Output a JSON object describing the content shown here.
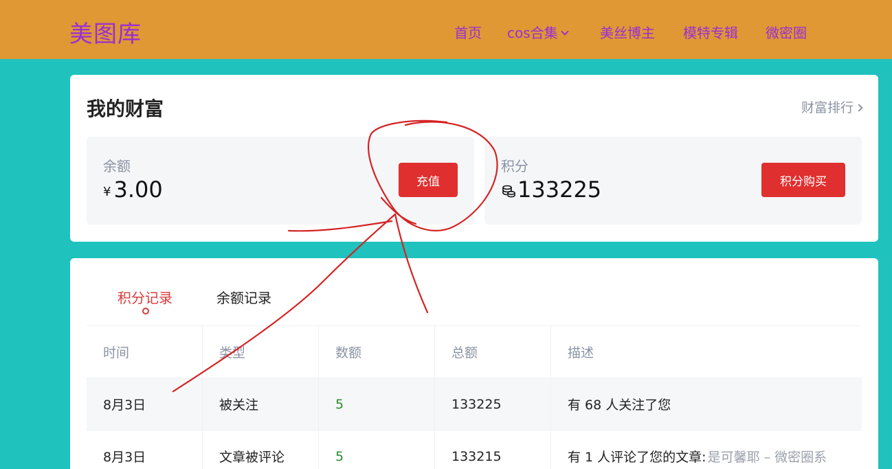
{
  "header": {
    "logo": "美图库",
    "nav": [
      "首页",
      "cos合集",
      "美丝博主",
      "模特专辑",
      "微密圈"
    ]
  },
  "wealth": {
    "title": "我的财富",
    "rank_link": "财富排行",
    "balance": {
      "label": "余额",
      "currency": "¥",
      "value": "3.00",
      "button": "充值"
    },
    "points": {
      "label": "积分",
      "value": "133225",
      "button": "积分购买"
    }
  },
  "records": {
    "tabs": [
      "积分记录",
      "余额记录"
    ],
    "columns": [
      "时间",
      "类型",
      "数额",
      "总额",
      "描述"
    ],
    "rows": [
      {
        "time": "8月3日",
        "type": "被关注",
        "amount": "5",
        "total": "133225",
        "desc": "有 68 人关注了您",
        "desc_extra": ""
      },
      {
        "time": "8月3日",
        "type": "文章被评论",
        "amount": "5",
        "total": "133215",
        "desc": "有 1 人评论了您的文章:",
        "desc_extra": "是可馨耶 – 微密圈系"
      }
    ]
  },
  "colors": {
    "background": "#1fc2bd",
    "header": "#df9834",
    "nav_text": "#9b2ed3",
    "button_red": "#e02f2f",
    "amount_green": "#2a8a2a",
    "annotation": "#d42323"
  }
}
